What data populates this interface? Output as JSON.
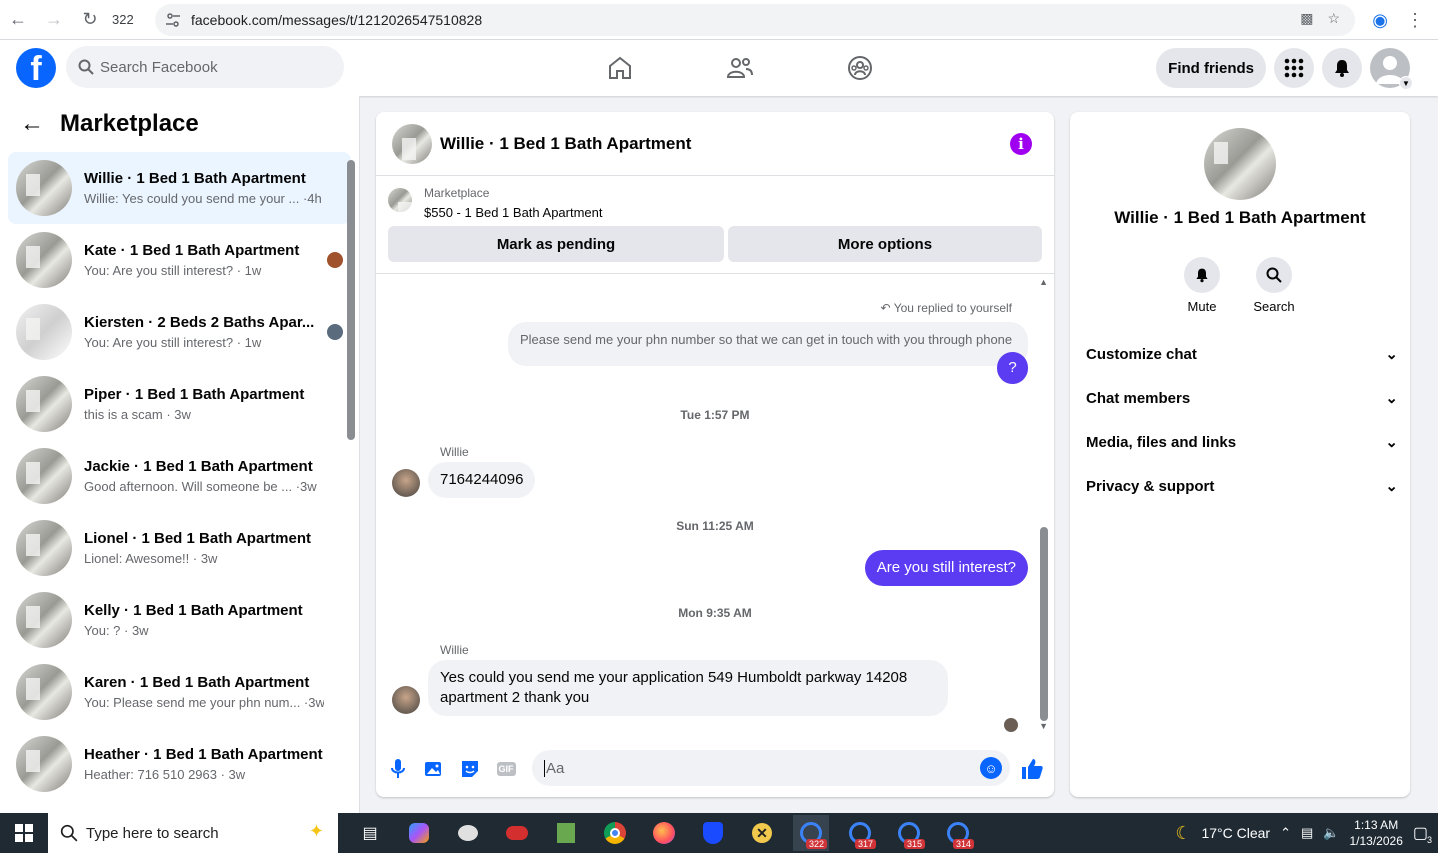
{
  "browser": {
    "tab_count": "322",
    "url": "facebook.com/messages/t/1212026547510828"
  },
  "fb": {
    "search_placeholder": "Search Facebook",
    "find_friends": "Find friends"
  },
  "sidebar": {
    "title": "Marketplace",
    "conversations": [
      {
        "title": "Willie · 1 Bed 1 Bath Apartment",
        "sub": "Willie: Yes could you send me your ... ·4h"
      },
      {
        "title": "Kate · 1 Bed 1 Bath Apartment",
        "sub": "You: Are you still interest? · 1w"
      },
      {
        "title": "Kiersten · 2 Beds 2 Baths Apar...",
        "sub": "You: Are you still interest? · 1w"
      },
      {
        "title": "Piper · 1 Bed 1 Bath Apartment",
        "sub": "this is a scam · 3w"
      },
      {
        "title": "Jackie · 1 Bed 1 Bath Apartment",
        "sub": "Good afternoon. Will someone be ... ·3w"
      },
      {
        "title": "Lionel · 1 Bed 1 Bath Apartment",
        "sub": "Lionel: Awesome!! · 3w"
      },
      {
        "title": "Kelly · 1 Bed 1 Bath Apartment",
        "sub": "You: ? · 3w"
      },
      {
        "title": "Karen · 1 Bed 1 Bath Apartment",
        "sub": "You: Please send me your phn num... ·3w"
      },
      {
        "title": "Heather · 1 Bed 1 Bath Apartment",
        "sub": "Heather: 716 510 2963 · 3w"
      }
    ]
  },
  "chat": {
    "title": "Willie · 1 Bed 1 Bath Apartment",
    "marketplace_label": "Marketplace",
    "listing": "$550 - 1 Bed 1 Bath Apartment",
    "mark_pending": "Mark as pending",
    "more_options": "More options",
    "replied_note": "You replied to yourself",
    "msg_phn": "Please send me your phn number so that we can get in touch with you through phone",
    "msg_q": "?",
    "ts1": "Tue 1:57 PM",
    "sender1": "Willie",
    "msg_number": "7164244096",
    "ts2": "Sun 11:25 AM",
    "msg_interest": "Are you still interest?",
    "ts3": "Mon 9:35 AM",
    "sender2": "Willie",
    "msg_app": "Yes could you send me your application 549 Humboldt parkway 14208 apartment 2 thank you",
    "input_placeholder": "Aa"
  },
  "info": {
    "name": "Willie · 1 Bed 1 Bath Apartment",
    "mute": "Mute",
    "search": "Search",
    "sections": [
      "Customize chat",
      "Chat members",
      "Media, files and links",
      "Privacy & support"
    ]
  },
  "taskbar": {
    "search": "Type here to search",
    "weather": "17°C  Clear",
    "time": "1:13 AM",
    "date": "1/13/2026",
    "notif": "3",
    "badges": [
      "322",
      "317",
      "315",
      "314"
    ]
  }
}
